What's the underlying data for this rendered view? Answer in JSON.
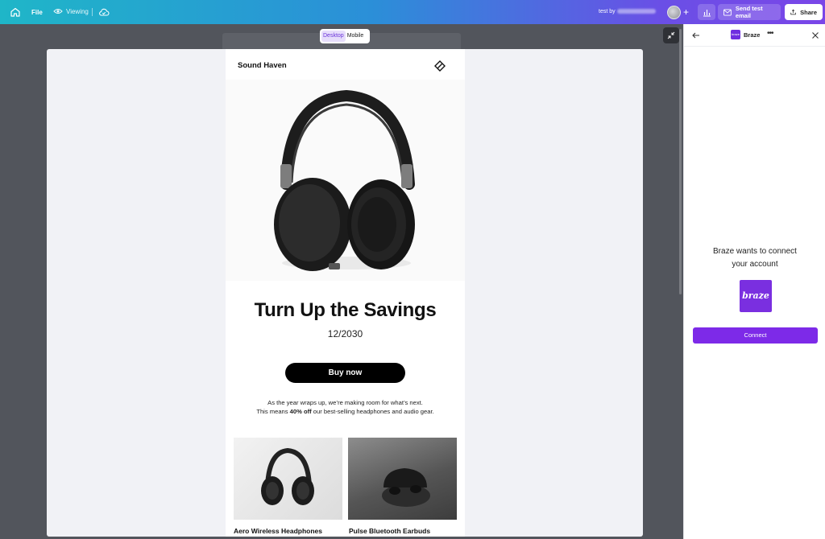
{
  "topbar": {
    "file_label": "File",
    "viewing_label": "Viewing",
    "user_prefix": "test by",
    "plus": "+",
    "send_test_label": "Send test email",
    "share_label": "Share"
  },
  "canvas": {
    "toggle": {
      "desktop": "Desktop",
      "mobile": "Mobile"
    }
  },
  "email": {
    "brand": "Sound Haven",
    "headline": "Turn Up the Savings",
    "date": "12/2030",
    "cta": "Buy now",
    "body_line1": "As the year wraps up, we’re making room for what’s next.",
    "body_line2_pre": "This means ",
    "body_line2_bold": "40% off",
    "body_line2_post": " our best-selling headphones and audio gear.",
    "products": [
      {
        "title": "Aero Wireless Headphones"
      },
      {
        "title": "Pulse Bluetooth Earbuds"
      }
    ]
  },
  "panel": {
    "app_name": "Braze",
    "app_badge": "braze",
    "more": "•••",
    "connect_line1": "Braze wants to connect",
    "connect_line2": "your account",
    "logo_text": "braze",
    "connect_button": "Connect"
  },
  "colors": {
    "accent": "#7d2ae8",
    "gradient_start": "#1fb6c8",
    "gradient_end": "#7a46e8"
  }
}
